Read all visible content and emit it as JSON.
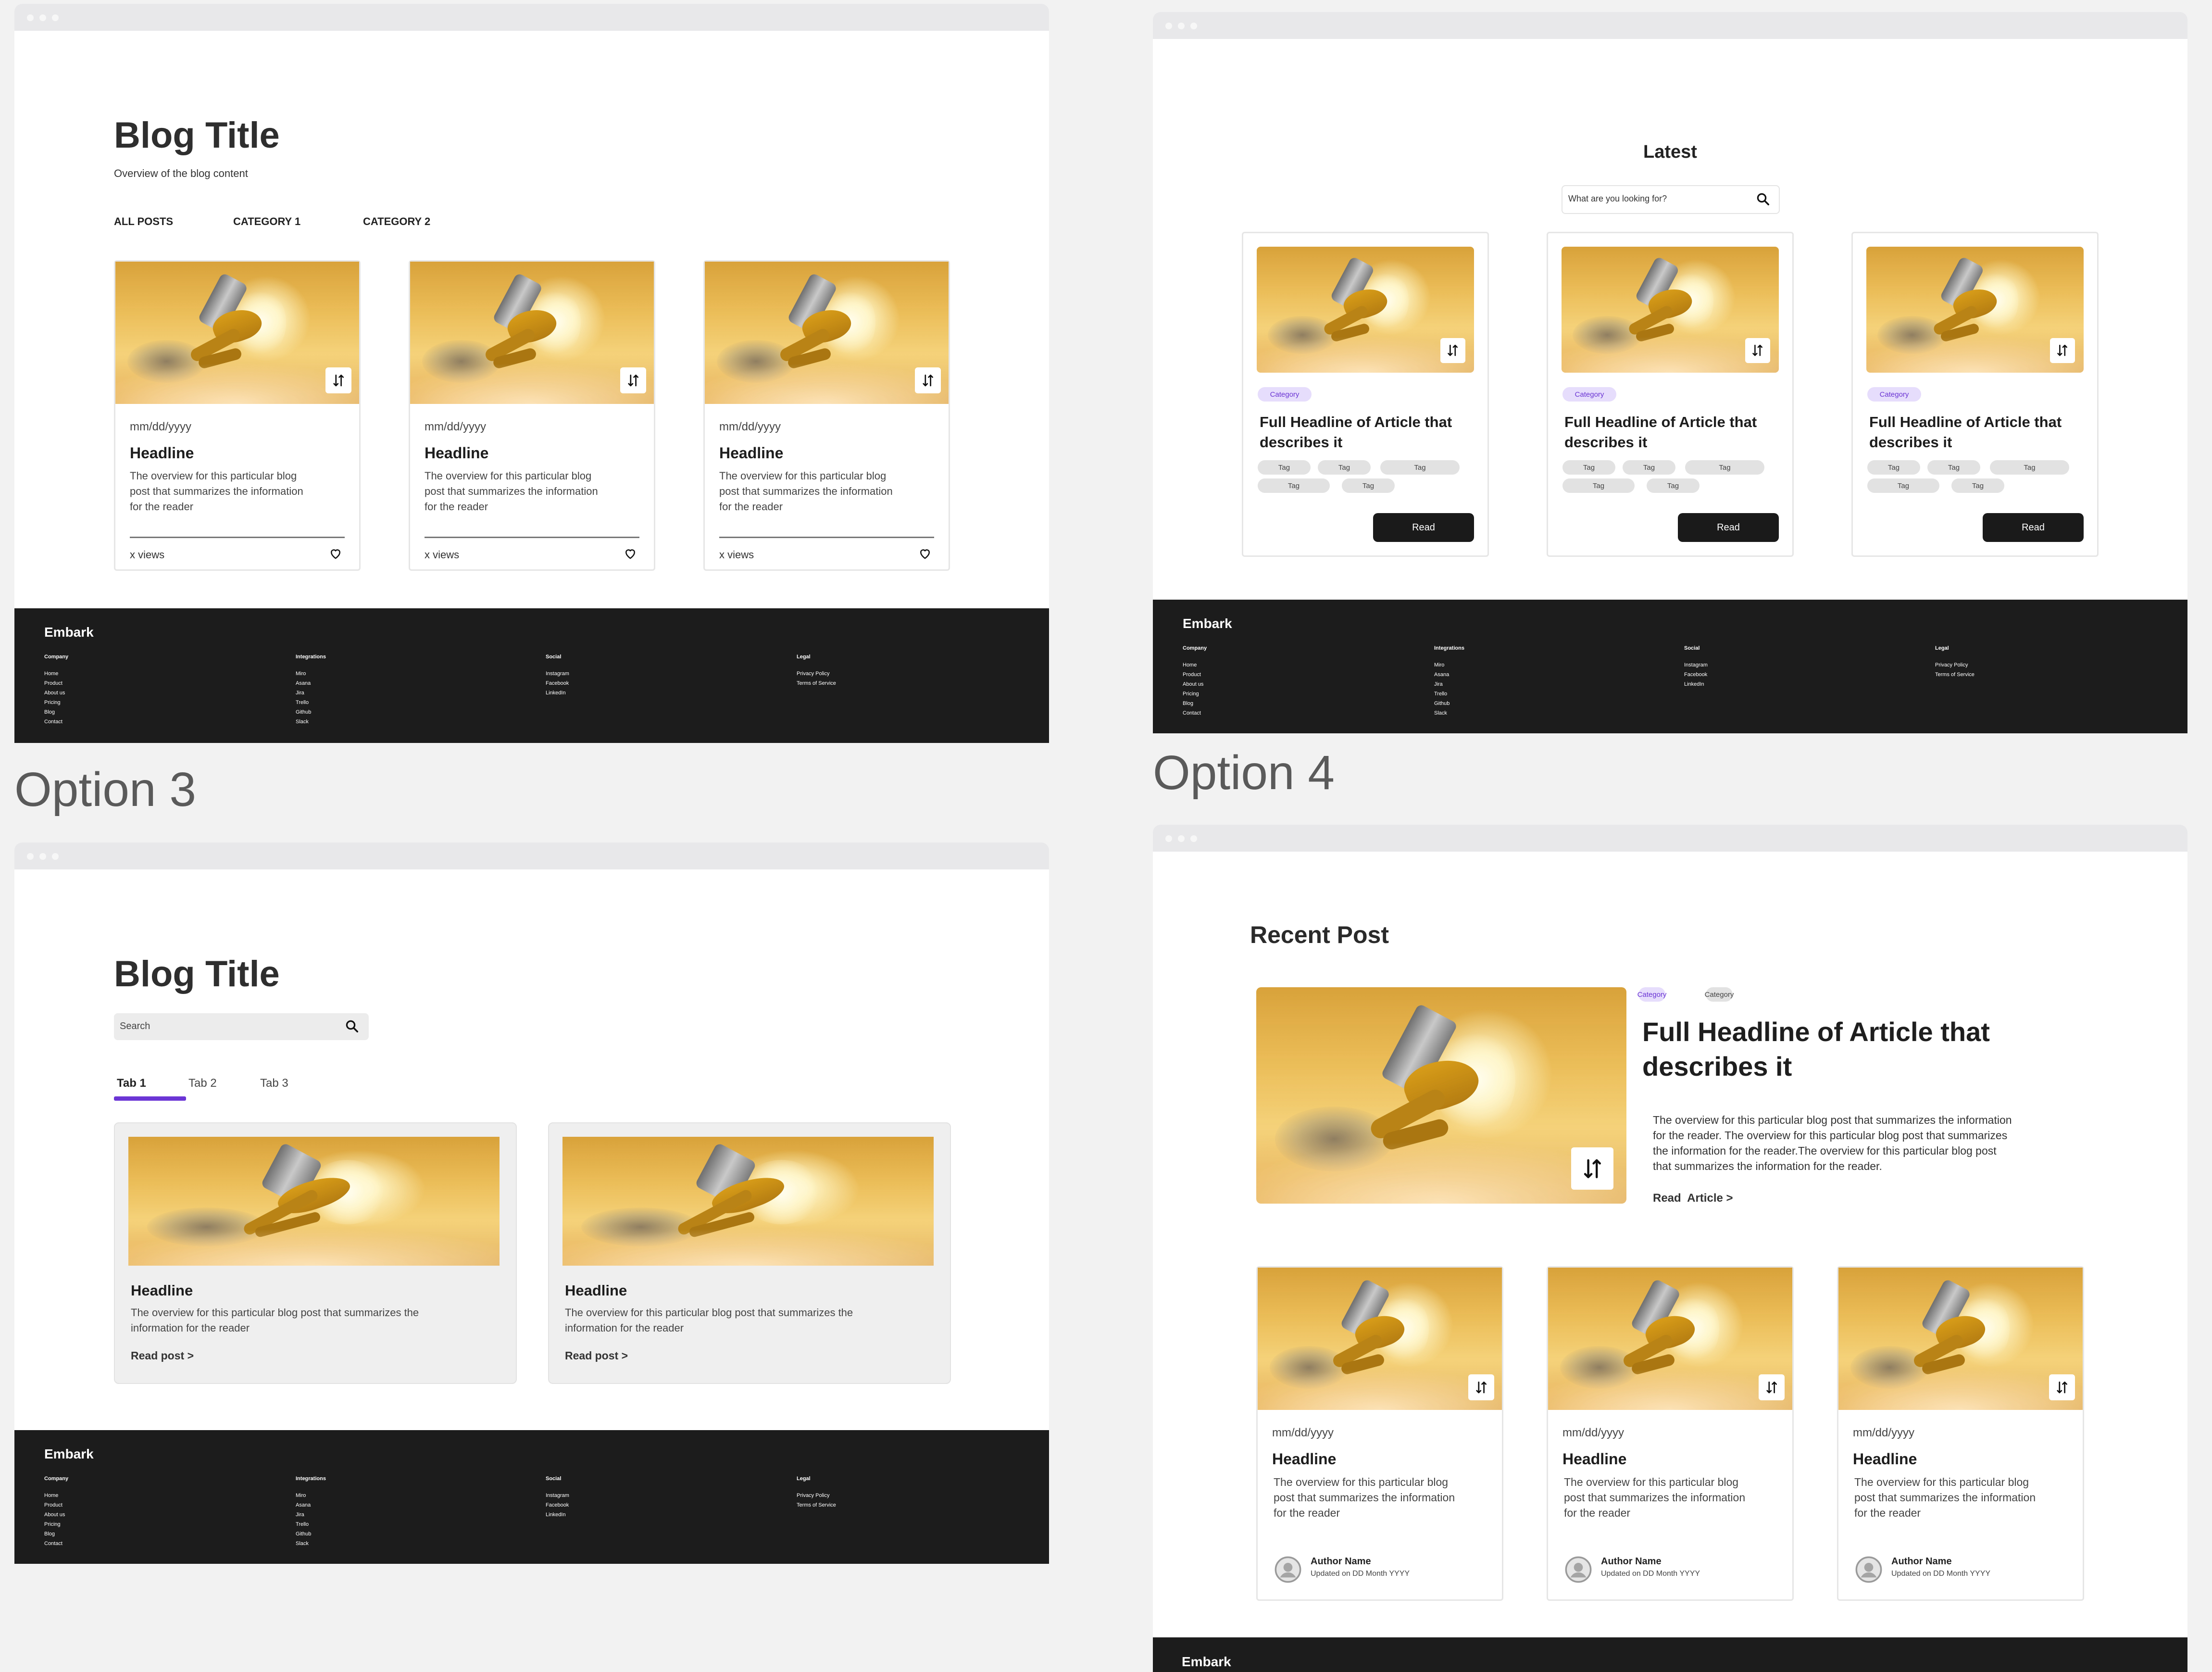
{
  "options": {
    "option3_label": "Option 3",
    "option4_label": "Option 4"
  },
  "footer": {
    "brand": "Embark",
    "columns": [
      {
        "title": "Company",
        "links": [
          "Home",
          "Product",
          "About us",
          "Pricing",
          "Blog",
          "Contact"
        ]
      },
      {
        "title": "Integrations",
        "links": [
          "Miro",
          "Asana",
          "Jira",
          "Trello",
          "Github",
          "Slack"
        ]
      },
      {
        "title": "Social",
        "links": [
          "Instagram",
          "Facebook",
          "LinkedIn"
        ]
      },
      {
        "title": "Legal",
        "links": [
          "Privacy Policy",
          "Terms of Service"
        ]
      }
    ]
  },
  "option1": {
    "title": "Blog Title",
    "subtitle": "Overview of the blog content",
    "nav": [
      "ALL POSTS",
      "CATEGORY 1",
      "CATEGORY 2"
    ],
    "cards": [
      {
        "date": "mm/dd/yyyy",
        "headline": "Headline",
        "overview": [
          "The overview for this particular blog",
          "post that summarizes the information",
          "for the reader"
        ],
        "views": "x views"
      },
      {
        "date": "mm/dd/yyyy",
        "headline": "Headline",
        "overview": [
          "The overview for this particular blog",
          "post that summarizes the information",
          "for the reader"
        ],
        "views": "x views"
      },
      {
        "date": "mm/dd/yyyy",
        "headline": "Headline",
        "overview": [
          "The overview for this particular blog",
          "post that summarizes the information",
          "for the reader"
        ],
        "views": "x views"
      }
    ]
  },
  "option2": {
    "title": "Latest",
    "search_placeholder": "What are you looking for?",
    "cards": [
      {
        "category": "Category",
        "headline": [
          "Full Headline of Article that",
          "describes it"
        ],
        "tags": [
          "Tag",
          "Tag",
          "Tag",
          "Tag",
          "Tag"
        ],
        "button": "Read"
      },
      {
        "category": "Category",
        "headline": [
          "Full Headline of Article that",
          "describes it"
        ],
        "tags": [
          "Tag",
          "Tag",
          "Tag",
          "Tag",
          "Tag"
        ],
        "button": "Read"
      },
      {
        "category": "Category",
        "headline": [
          "Full Headline of Article that",
          "describes it"
        ],
        "tags": [
          "Tag",
          "Tag",
          "Tag",
          "Tag",
          "Tag"
        ],
        "button": "Read"
      }
    ]
  },
  "option3": {
    "title": "Blog Title",
    "search_placeholder": "Search",
    "tabs": [
      "Tab 1",
      "Tab 2",
      "Tab 3"
    ],
    "active_tab": "Tab 1",
    "cards": [
      {
        "headline": "Headline",
        "overview": [
          "The overview for this particular blog post that summarizes the",
          "information for the reader"
        ],
        "link": "Read post >"
      },
      {
        "headline": "Headline",
        "overview": [
          "The overview for this particular blog post that summarizes the",
          "information for the reader"
        ],
        "link": "Read post >"
      }
    ]
  },
  "option4": {
    "title": "Recent Post",
    "featured": {
      "categories": [
        "Category",
        "Category"
      ],
      "headline": [
        "Full Headline of Article that",
        "describes it"
      ],
      "overview": [
        "The overview for this particular blog post that summarizes the information",
        "for the reader. The overview for this particular blog post that summarizes",
        "the information for the reader.The overview for this particular blog post",
        "that summarizes the information for the reader."
      ],
      "link": "Read  Article >"
    },
    "cards": [
      {
        "date": "mm/dd/yyyy",
        "headline": "Headline",
        "overview": [
          "The overview for this particular blog",
          "post that summarizes the information",
          "for the reader"
        ],
        "author": "Author Name",
        "updated": "Updated on DD Month YYYY"
      },
      {
        "date": "mm/dd/yyyy",
        "headline": "Headline",
        "overview": [
          "The overview for this particular blog",
          "post that summarizes the information",
          "for the reader"
        ],
        "author": "Author Name",
        "updated": "Updated on DD Month YYYY"
      },
      {
        "date": "mm/dd/yyyy",
        "headline": "Headline",
        "overview": [
          "The overview for this particular blog",
          "post that summarizes the information",
          "for the reader"
        ],
        "author": "Author Name",
        "updated": "Updated on DD Month YYYY"
      }
    ],
    "footer_brand": "Embark"
  },
  "colors": {
    "accent_purple": "#6a35d4",
    "category_pill": "#e6dcfb",
    "tag_pill": "#e2e2e2",
    "footer_bg": "#1c1c1c"
  }
}
